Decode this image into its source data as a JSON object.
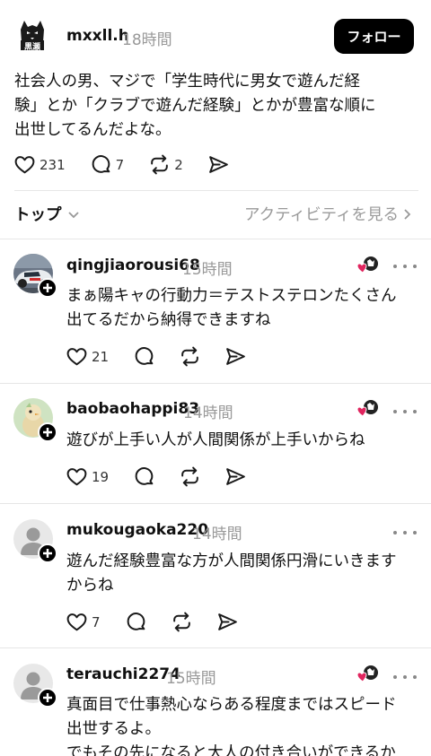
{
  "post": {
    "username": "mxxll.h",
    "time": "18時間",
    "avatar_text": "黒瀬",
    "follow_label": "フォロー",
    "body": "社会人の男、マジで「学生時代に男女で遊んだ経\n験」とか「クラブで遊んだ経験」とかが豊富な順に\n出世してるんだよな。",
    "likes": "231",
    "comments": "7",
    "reposts": "2"
  },
  "sort": {
    "label": "トップ",
    "activity_label": "アクティビティを見る"
  },
  "replies": [
    {
      "username": "qingjiaorousi68",
      "time": "15時間",
      "body": "まぁ陽キャの行動力＝テストステロンたくさん\n出てるだから納得できますね",
      "likes": "21",
      "avatar": "car"
    },
    {
      "username": "baobaohappi83",
      "time": "14時間",
      "body": "遊びが上手い人が人間関係が上手いからね",
      "likes": "19",
      "avatar": "bird"
    },
    {
      "username": "mukougaoka220",
      "time": "14時間",
      "body": "遊んだ経験豊富な方が人間関係円滑にいきます\nからね",
      "likes": "7",
      "avatar": "default"
    },
    {
      "username": "terauchi2274",
      "time": "15時間",
      "body": "真面目で仕事熱心ならある程度まではスピード\n出世するよ。\nでもその先になると大人の付き合いができるか",
      "likes": "",
      "avatar": "default"
    }
  ],
  "colors": {
    "text": "#101010",
    "muted": "#999999",
    "button_bg": "#000000",
    "heart_badge": "#e0245e",
    "divider": "#e6e6e6"
  },
  "icons": {
    "like": "heart-icon",
    "comment": "comment-bubble-icon",
    "repost": "repost-icon",
    "share": "send-icon",
    "more": "more-dots-icon"
  }
}
